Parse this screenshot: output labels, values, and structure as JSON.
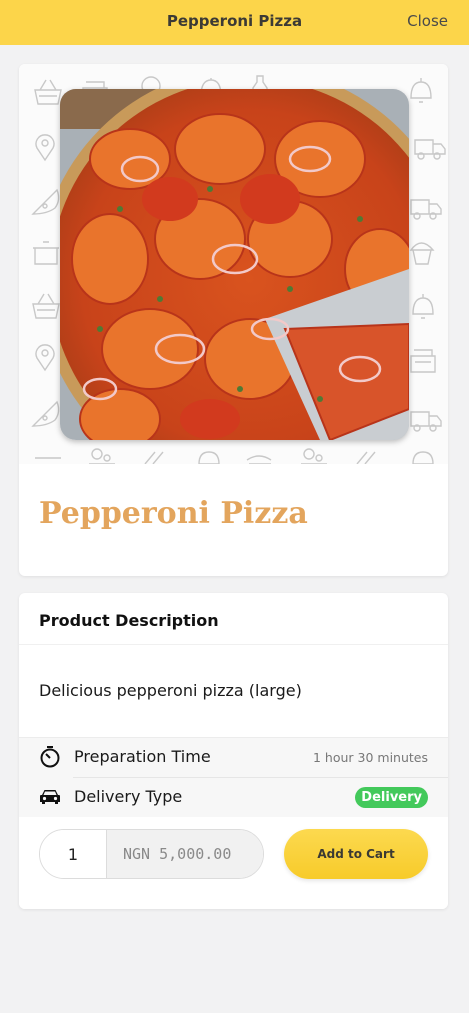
{
  "header": {
    "title": "Pepperoni Pizza",
    "close_label": "Close"
  },
  "product": {
    "name": "Pepperoni Pizza",
    "image_alt": "pizza photo"
  },
  "description": {
    "heading": "Product Description",
    "text": "Delicious pepperoni pizza (large)"
  },
  "details": {
    "prep_label": "Preparation Time",
    "prep_value": "1 hour 30 minutes",
    "delivery_label": "Delivery Type",
    "delivery_value": "Delivery"
  },
  "cart": {
    "quantity": "1",
    "price": "NGN 5,000.00",
    "add_label": "Add to Cart"
  },
  "colors": {
    "header_bg": "#fcd54a",
    "product_name": "#e3a55d",
    "badge_green": "#43c95b",
    "button_yellow": "#f7cb2a"
  },
  "icons": [
    "timer-icon",
    "car-icon",
    "basket-icon",
    "bell-icon",
    "location-pin-icon",
    "truck-icon",
    "cupcake-icon",
    "pot-icon",
    "pizza-slice-icon"
  ]
}
